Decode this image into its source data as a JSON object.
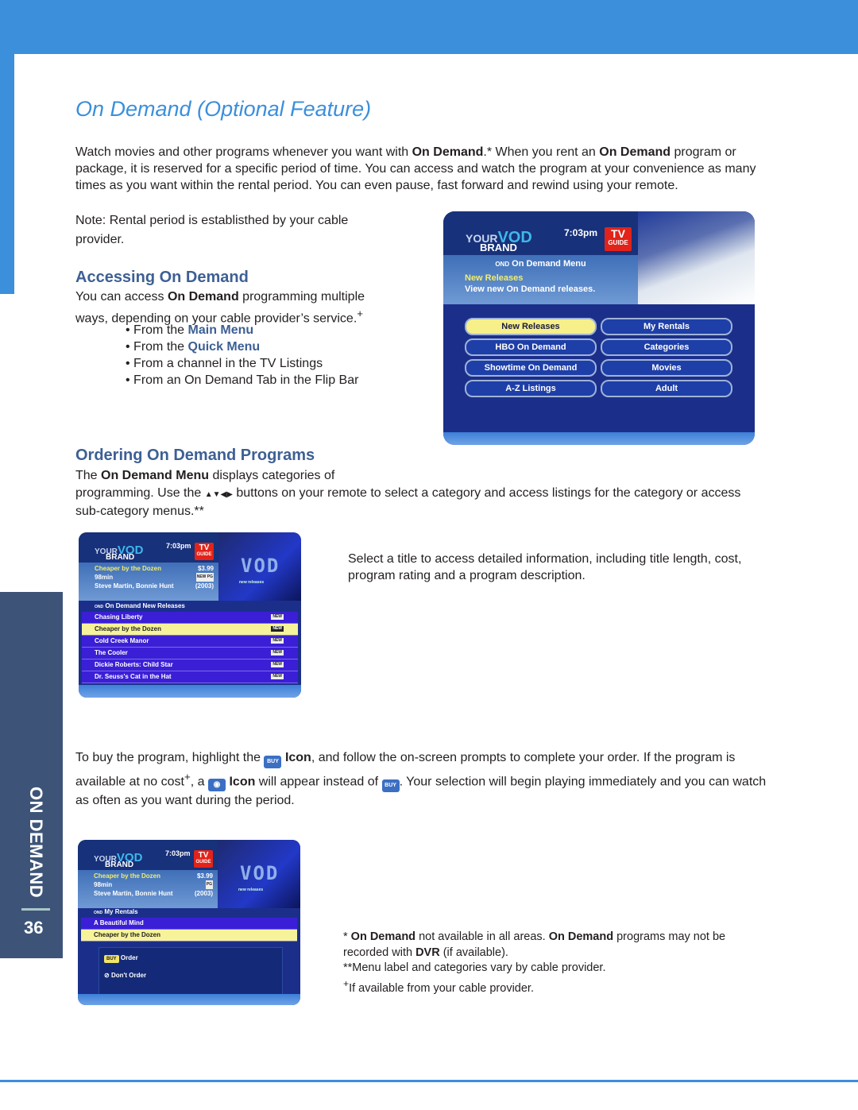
{
  "page": {
    "section_tab": "ON DEMAND",
    "page_number": "36",
    "colors": {
      "brand_blue": "#3b8fdb",
      "heading": "#3d5f94",
      "side_tab": "#3d5478"
    }
  },
  "title": "On Demand  (Optional Feature)",
  "intro": {
    "t1": "Watch movies and other programs whenever you want with ",
    "b1": "On Demand",
    "t2": ".* When you rent an ",
    "b2": "On Demand",
    "t3": " program or package, it is reserved for a specific period of time. You can access and watch the program at your convenience as many times as you want within the rental period. You can even pause, fast forward and rewind using your remote."
  },
  "note": "Note:  Rental period is establisthed by your cable provider.",
  "accessing": {
    "heading": "Accessing On Demand",
    "t1": "You can access ",
    "b1": "On Demand",
    "t2": " programming multiple ways, depending on your cable provider’s service.",
    "sup": "+",
    "items": [
      {
        "pre": "• From the ",
        "hl": "Main Menu"
      },
      {
        "pre": "• From the ",
        "hl": "Quick Menu"
      },
      {
        "pre": "• From a channel in the TV Listings",
        "hl": ""
      },
      {
        "pre": "• From an On Demand Tab in the Flip Bar",
        "hl": ""
      }
    ]
  },
  "ordering": {
    "heading": "Ordering On Demand Programs",
    "t1": "The ",
    "b1": "On Demand Menu",
    "t2": " displays categories of",
    "t3": "programming. Use the ",
    "arrows": "▲▼◀▶",
    "t4": " buttons on your remote to select a category and access listings for the category or access sub-category menus.**"
  },
  "select_text": "Select a title to access detailed information, including title length, cost, program rating and a program description.",
  "buy": {
    "t1": "To buy the program, highlight the ",
    "buy_icon": "BUY",
    "b1": "Icon",
    "t2": ", and follow the on-screen prompts to complete your order. If the program is available at no cost",
    "sup": "+",
    "t3": ", a ",
    "b2": "Icon",
    "t4": " will appear instead of ",
    "t5": ". Your selection will begin playing immediately and you can watch as often as you want during the period."
  },
  "footnotes": {
    "f1a": "* ",
    "f1b": "On Demand",
    "f1c": " not available in all areas. ",
    "f1d": "On Demand",
    "f1e": " programs may not be recorded with ",
    "f1f": "DVR",
    "f1g": " (if available).",
    "f2": "**Menu label and categories vary by cable provider.",
    "f3sup": "+",
    "f3": "If available from your cable provider."
  },
  "tv_common": {
    "logo_your": "YOUR",
    "logo_vod": "VOD",
    "logo_brand": "BRAND",
    "time": "7:03pm",
    "tvguide_tv": "TV",
    "tvguide_guide": "GUIDE",
    "ond": "OND",
    "vod_art": "VOD",
    "vod_art_sub": "new releases"
  },
  "screen1": {
    "menu_title": "On Demand Menu",
    "selected": "New Releases",
    "desc": "View new On Demand releases.",
    "buttons": [
      "New Releases",
      "My Rentals",
      "HBO On Demand",
      "Categories",
      "Showtime On Demand",
      "Movies",
      "A-Z Listings",
      "Adult"
    ]
  },
  "screen2": {
    "info_title": "Cheaper by the Dozen",
    "price": "$3.99",
    "length": "98min",
    "badge_new": "NEW",
    "rating": "PG",
    "cast": "Steve Martin, Bonnie Hunt",
    "year": "(2003)",
    "list_title": "On Demand New Releases",
    "rows": [
      "Chasing Liberty",
      "Cheaper by the Dozen",
      "Cold Creek Manor",
      "The Cooler",
      "Dickie Roberts: Child Star",
      "Dr. Seuss's Cat in the Hat"
    ],
    "row_badge": "NEW"
  },
  "screen3": {
    "info_title": "Cheaper by the Dozen",
    "price": "$3.99",
    "length": "98min",
    "rating": "PG",
    "cast": "Steve Martin, Bonnie Hunt",
    "year": "(2003)",
    "list_title": "My Rentals",
    "rows": [
      "A Beautiful Mind",
      "Cheaper by the Dozen"
    ],
    "buy_badge": "BUY",
    "order": "Order",
    "dont_order": "Don't Order"
  }
}
